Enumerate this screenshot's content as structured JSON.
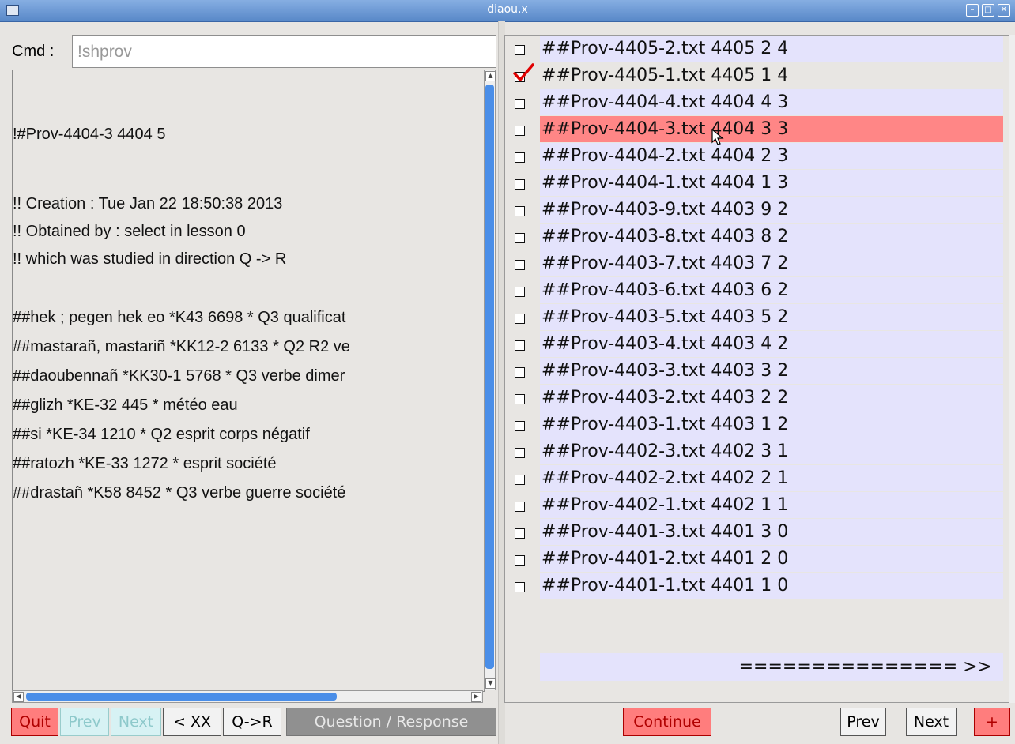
{
  "window": {
    "title": "diaou.x"
  },
  "cmd": {
    "label": "Cmd :",
    "value": "!shprov"
  },
  "text_lines": [
    "!#Prov-4404-3   4404   5",
    "!!   Creation :  Tue Jan 22 18:50:38 2013",
    "!!   Obtained by : select in lesson 0",
    "!!   which was studied in direction Q -> R",
    "##hek ; pegen hek eo *K43 6698 * Q3 qualificat",
    "##mastarañ, mastariñ *KK12-2 6133 * Q2 R2 ve",
    "##daoubennañ *KK30-1 5768 * Q3 verbe dimer",
    "##glizh *KE-32 445 * météo eau",
    "##si *KE-34 1210 * Q2 esprit corps négatif",
    "##ratozh *KE-33 1272 * esprit société",
    "##drastañ *K58 8452 * Q3 verbe guerre société"
  ],
  "buttons": {
    "quit": "Quit",
    "prev": "Prev",
    "next": "Next",
    "xx": "< XX",
    "qr": "Q->R",
    "question_response": "Question / Response",
    "continue": "Continue",
    "right_prev": "Prev",
    "right_next": "Next",
    "plus": "+"
  },
  "list_items": [
    {
      "label": "##Prov-4405-2.txt 4405 2 4",
      "checked": false,
      "selected": false
    },
    {
      "label": "##Prov-4405-1.txt 4405 1 4",
      "checked": true,
      "selected": false
    },
    {
      "label": "##Prov-4404-4.txt 4404 4 3",
      "checked": false,
      "selected": false
    },
    {
      "label": "##Prov-4404-3.txt 4404 3 3",
      "checked": false,
      "selected": true
    },
    {
      "label": "##Prov-4404-2.txt 4404 2 3",
      "checked": false,
      "selected": false
    },
    {
      "label": "##Prov-4404-1.txt 4404 1 3",
      "checked": false,
      "selected": false
    },
    {
      "label": "##Prov-4403-9.txt 4403 9 2",
      "checked": false,
      "selected": false
    },
    {
      "label": "##Prov-4403-8.txt 4403 8 2",
      "checked": false,
      "selected": false
    },
    {
      "label": "##Prov-4403-7.txt 4403 7 2",
      "checked": false,
      "selected": false
    },
    {
      "label": "##Prov-4403-6.txt 4403 6 2",
      "checked": false,
      "selected": false
    },
    {
      "label": "##Prov-4403-5.txt 4403 5 2",
      "checked": false,
      "selected": false
    },
    {
      "label": "##Prov-4403-4.txt 4403 4 2",
      "checked": false,
      "selected": false
    },
    {
      "label": "##Prov-4403-3.txt 4403 3 2",
      "checked": false,
      "selected": false
    },
    {
      "label": "##Prov-4403-2.txt 4403 2 2",
      "checked": false,
      "selected": false
    },
    {
      "label": "##Prov-4403-1.txt 4403 1 2",
      "checked": false,
      "selected": false
    },
    {
      "label": "##Prov-4402-3.txt 4402 3 1",
      "checked": false,
      "selected": false
    },
    {
      "label": "##Prov-4402-2.txt 4402 2 1",
      "checked": false,
      "selected": false
    },
    {
      "label": "##Prov-4402-1.txt 4402 1 1",
      "checked": false,
      "selected": false
    },
    {
      "label": "##Prov-4401-3.txt 4401 3 0",
      "checked": false,
      "selected": false
    },
    {
      "label": "##Prov-4401-2.txt 4401 2 0",
      "checked": false,
      "selected": false
    },
    {
      "label": "##Prov-4401-1.txt 4401 1 0",
      "checked": false,
      "selected": false
    }
  ],
  "footer_link": "=============== >>",
  "colors": {
    "selected_row": "#ff8686",
    "row_background": "#e4e3fc",
    "scroll_thumb": "#4a8ee8",
    "title_bar": "#5888c8"
  }
}
